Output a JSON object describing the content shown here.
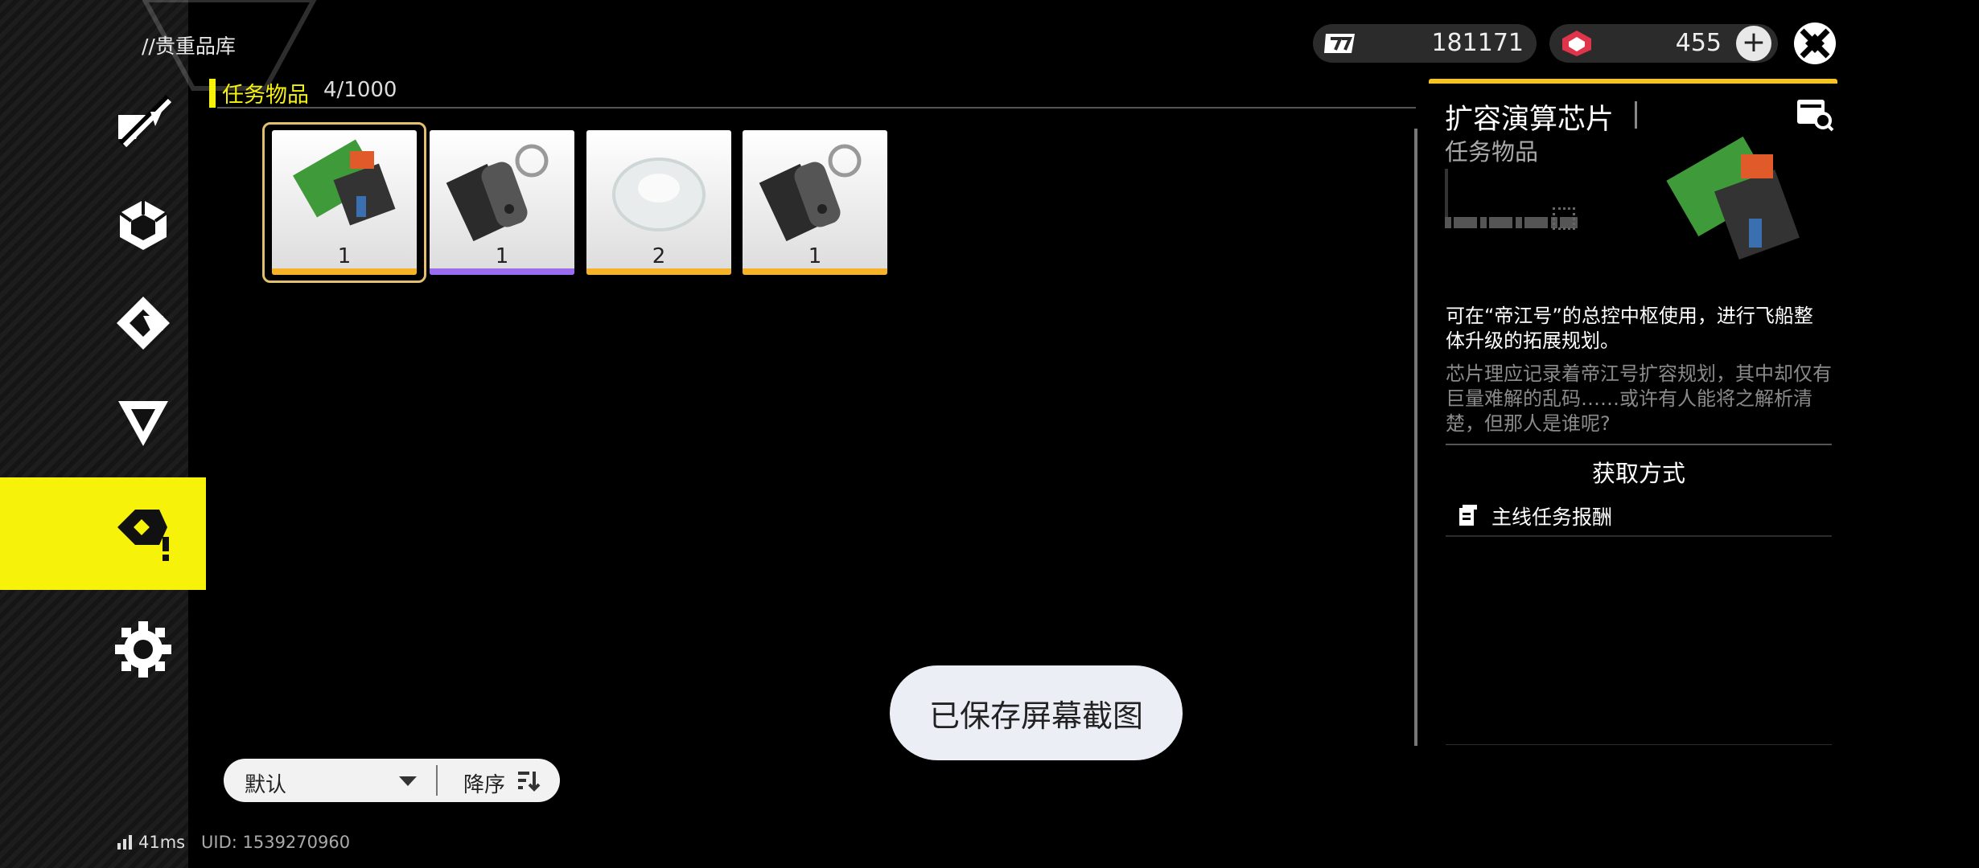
{
  "header": {
    "breadcrumb": "//贵重品库"
  },
  "currency": {
    "credits_value": "181171",
    "gems_value": "455",
    "credits_icon": "credits-icon",
    "gems_icon": "gem-icon"
  },
  "sidebar": {
    "items": [
      {
        "icon": "stylus-icon",
        "active": false
      },
      {
        "icon": "cube-icon",
        "active": false
      },
      {
        "icon": "diamond-badge-icon",
        "active": false
      },
      {
        "icon": "triangle-icon",
        "active": false
      },
      {
        "icon": "mission-item-icon",
        "active": true
      },
      {
        "icon": "gear-icon",
        "active": false
      }
    ]
  },
  "category": {
    "title": "任务物品",
    "count": "4/1000"
  },
  "items": [
    {
      "name": "chip",
      "qty": "1",
      "rarity_color": "#f6b228"
    },
    {
      "name": "tag",
      "qty": "1",
      "rarity_color": "#9a6cf0"
    },
    {
      "name": "crystal",
      "qty": "2",
      "rarity_color": "#f6b228"
    },
    {
      "name": "tag",
      "qty": "1",
      "rarity_color": "#f6b228"
    }
  ],
  "detail": {
    "title": "扩容演算芯片",
    "type": "任务物品",
    "description": "可在“帝江号”的总控中枢使用，进行飞船整体升级的拓展规划。",
    "flavor": "芯片理应记录着帝江号扩容规划，其中却仅有巨量难解的乱码……或许有人能将之解析清楚，但那人是谁呢?",
    "source_title": "获取方式",
    "source_item": "主线任务报酬"
  },
  "sort": {
    "label": "默认",
    "order_label": "降序"
  },
  "toast": {
    "text": "已保存屏幕截图"
  },
  "footer": {
    "ping": "41ms",
    "uid": "UID: 1539270960"
  },
  "colors": {
    "accent": "#f6f20a",
    "gold": "#f6b228",
    "purple": "#9a6cf0"
  }
}
